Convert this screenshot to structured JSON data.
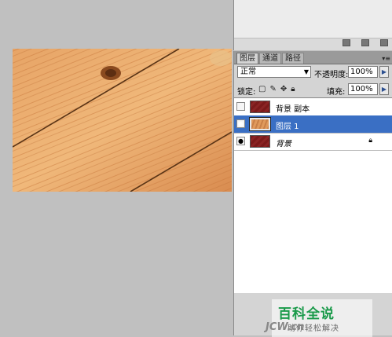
{
  "layers_panel": {
    "tabs": [
      "图层",
      "通道",
      "路径"
    ],
    "blend_mode": "正常",
    "opacity_label": "不透明度:",
    "opacity_value": "100%",
    "lock_label": "锁定:",
    "fill_label": "填充:",
    "fill_value": "100%",
    "layers": [
      {
        "name": "背景 副本",
        "visible": false,
        "thumbnail": "dark-red-texture",
        "selected": false,
        "locked": false
      },
      {
        "name": "图层 1",
        "visible": true,
        "thumbnail": "wood-texture",
        "selected": true,
        "locked": false
      },
      {
        "name": "背景",
        "visible": true,
        "thumbnail": "dark-red-texture",
        "selected": false,
        "locked": true
      }
    ]
  },
  "watermark": {
    "title": "百科全说",
    "subtitle": "助你轻松解决",
    "site": "JCW.cn"
  },
  "colors": {
    "selection": "#3a6fc4",
    "watermark_green": "#1a9a4a",
    "canvas_gray": "#c0c0c0"
  }
}
